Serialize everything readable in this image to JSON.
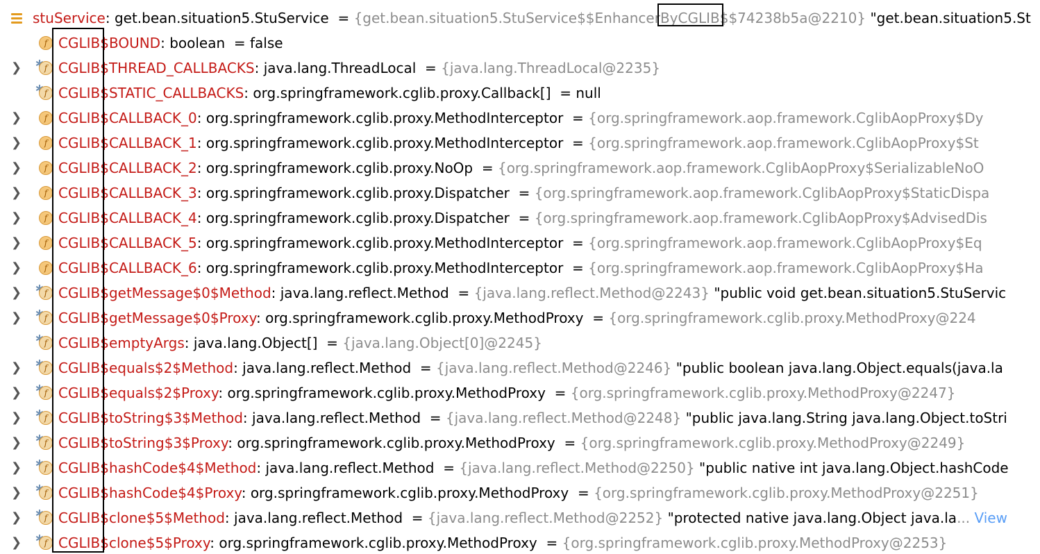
{
  "root": {
    "name": "stuService",
    "type": "get.bean.situation5.StuService",
    "value": "{get.bean.situation5.StuService$$EnhancerByCGLIB$$74238b5a@2210}",
    "string_value": "\"get.bean.situation5.St"
  },
  "fields": [
    {
      "prefix": "CGLIB",
      "name": "$BOUND",
      "type": "boolean",
      "value": "false",
      "expandable": false,
      "static": false,
      "gray": false
    },
    {
      "prefix": "CGLIB",
      "name": "$THREAD_CALLBACKS",
      "type": "java.lang.ThreadLocal",
      "value": "{java.lang.ThreadLocal@2235}",
      "expandable": true,
      "static": true,
      "gray": true
    },
    {
      "prefix": "CGLIB",
      "name": "$STATIC_CALLBACKS",
      "type": "org.springframework.cglib.proxy.Callback[]",
      "value": "null",
      "expandable": false,
      "static": true,
      "gray": false
    },
    {
      "prefix": "CGLIB",
      "name": "$CALLBACK_0",
      "type": "org.springframework.cglib.proxy.MethodInterceptor",
      "value": "{org.springframework.aop.framework.CglibAopProxy$Dy",
      "expandable": true,
      "static": false,
      "gray": true
    },
    {
      "prefix": "CGLIB",
      "name": "$CALLBACK_1",
      "type": "org.springframework.cglib.proxy.MethodInterceptor",
      "value": "{org.springframework.aop.framework.CglibAopProxy$St",
      "expandable": true,
      "static": false,
      "gray": true
    },
    {
      "prefix": "CGLIB",
      "name": "$CALLBACK_2",
      "type": "org.springframework.cglib.proxy.NoOp",
      "value": "{org.springframework.aop.framework.CglibAopProxy$SerializableNoO",
      "expandable": true,
      "static": false,
      "gray": true
    },
    {
      "prefix": "CGLIB",
      "name": "$CALLBACK_3",
      "type": "org.springframework.cglib.proxy.Dispatcher",
      "value": "{org.springframework.aop.framework.CglibAopProxy$StaticDispa",
      "expandable": true,
      "static": false,
      "gray": true
    },
    {
      "prefix": "CGLIB",
      "name": "$CALLBACK_4",
      "type": "org.springframework.cglib.proxy.Dispatcher",
      "value": "{org.springframework.aop.framework.CglibAopProxy$AdvisedDis",
      "expandable": true,
      "static": false,
      "gray": true
    },
    {
      "prefix": "CGLIB",
      "name": "$CALLBACK_5",
      "type": "org.springframework.cglib.proxy.MethodInterceptor",
      "value": "{org.springframework.aop.framework.CglibAopProxy$Eq",
      "expandable": true,
      "static": false,
      "gray": true
    },
    {
      "prefix": "CGLIB",
      "name": "$CALLBACK_6",
      "type": "org.springframework.cglib.proxy.MethodInterceptor",
      "value": "{org.springframework.aop.framework.CglibAopProxy$Ha",
      "expandable": true,
      "static": false,
      "gray": true
    },
    {
      "prefix": "CGLIB",
      "name": "$getMessage$0$Method",
      "type": "java.lang.reflect.Method",
      "value": "{java.lang.reflect.Method@2243}",
      "string_value": "\"public void get.bean.situation5.StuServic",
      "expandable": true,
      "static": true,
      "gray": true
    },
    {
      "prefix": "CGLIB",
      "name": "$getMessage$0$Proxy",
      "type": "org.springframework.cglib.proxy.MethodProxy",
      "value": "{org.springframework.cglib.proxy.MethodProxy@224",
      "expandable": true,
      "static": true,
      "gray": true
    },
    {
      "prefix": "CGLIB",
      "name": "$emptyArgs",
      "type": "java.lang.Object[]",
      "value": "{java.lang.Object[0]@2245}",
      "expandable": false,
      "static": true,
      "gray": true
    },
    {
      "prefix": "CGLIB",
      "name": "$equals$2$Method",
      "type": "java.lang.reflect.Method",
      "value": "{java.lang.reflect.Method@2246}",
      "string_value": "\"public boolean java.lang.Object.equals(java.la",
      "expandable": true,
      "static": true,
      "gray": true
    },
    {
      "prefix": "CGLIB",
      "name": "$equals$2$Proxy",
      "type": "org.springframework.cglib.proxy.MethodProxy",
      "value": "{org.springframework.cglib.proxy.MethodProxy@2247}",
      "expandable": true,
      "static": true,
      "gray": true
    },
    {
      "prefix": "CGLIB",
      "name": "$toString$3$Method",
      "type": "java.lang.reflect.Method",
      "value": "{java.lang.reflect.Method@2248}",
      "string_value": "\"public java.lang.String java.lang.Object.toStri",
      "expandable": true,
      "static": true,
      "gray": true
    },
    {
      "prefix": "CGLIB",
      "name": "$toString$3$Proxy",
      "type": "org.springframework.cglib.proxy.MethodProxy",
      "value": "{org.springframework.cglib.proxy.MethodProxy@2249}",
      "expandable": true,
      "static": true,
      "gray": true
    },
    {
      "prefix": "CGLIB",
      "name": "$hashCode$4$Method",
      "type": "java.lang.reflect.Method",
      "value": "{java.lang.reflect.Method@2250}",
      "string_value": "\"public native int java.lang.Object.hashCode",
      "expandable": true,
      "static": true,
      "gray": true
    },
    {
      "prefix": "CGLIB",
      "name": "$hashCode$4$Proxy",
      "type": "org.springframework.cglib.proxy.MethodProxy",
      "value": "{org.springframework.cglib.proxy.MethodProxy@2251}",
      "expandable": true,
      "static": true,
      "gray": true
    },
    {
      "prefix": "CGLIB",
      "name": "$clone$5$Method",
      "type": "java.lang.reflect.Method",
      "value": "{java.lang.reflect.Method@2252}",
      "string_value": "\"protected native java.lang.Object java.la",
      "view_link": "View",
      "expandable": true,
      "static": true,
      "gray": true
    },
    {
      "prefix": "CGLIB",
      "name": "$clone$5$Proxy",
      "type": "org.springframework.cglib.proxy.MethodProxy",
      "value": "{org.springframework.cglib.proxy.MethodProxy@2253}",
      "expandable": true,
      "static": true,
      "gray": true
    }
  ],
  "icons": {
    "root": "field-list-icon",
    "field": "field-icon",
    "expand": "chevron-right-icon"
  },
  "colors": {
    "field_name": "#c41a16",
    "gray_value": "#8c8c8c",
    "icon_fill": "#f5c77a",
    "link": "#589df6"
  }
}
